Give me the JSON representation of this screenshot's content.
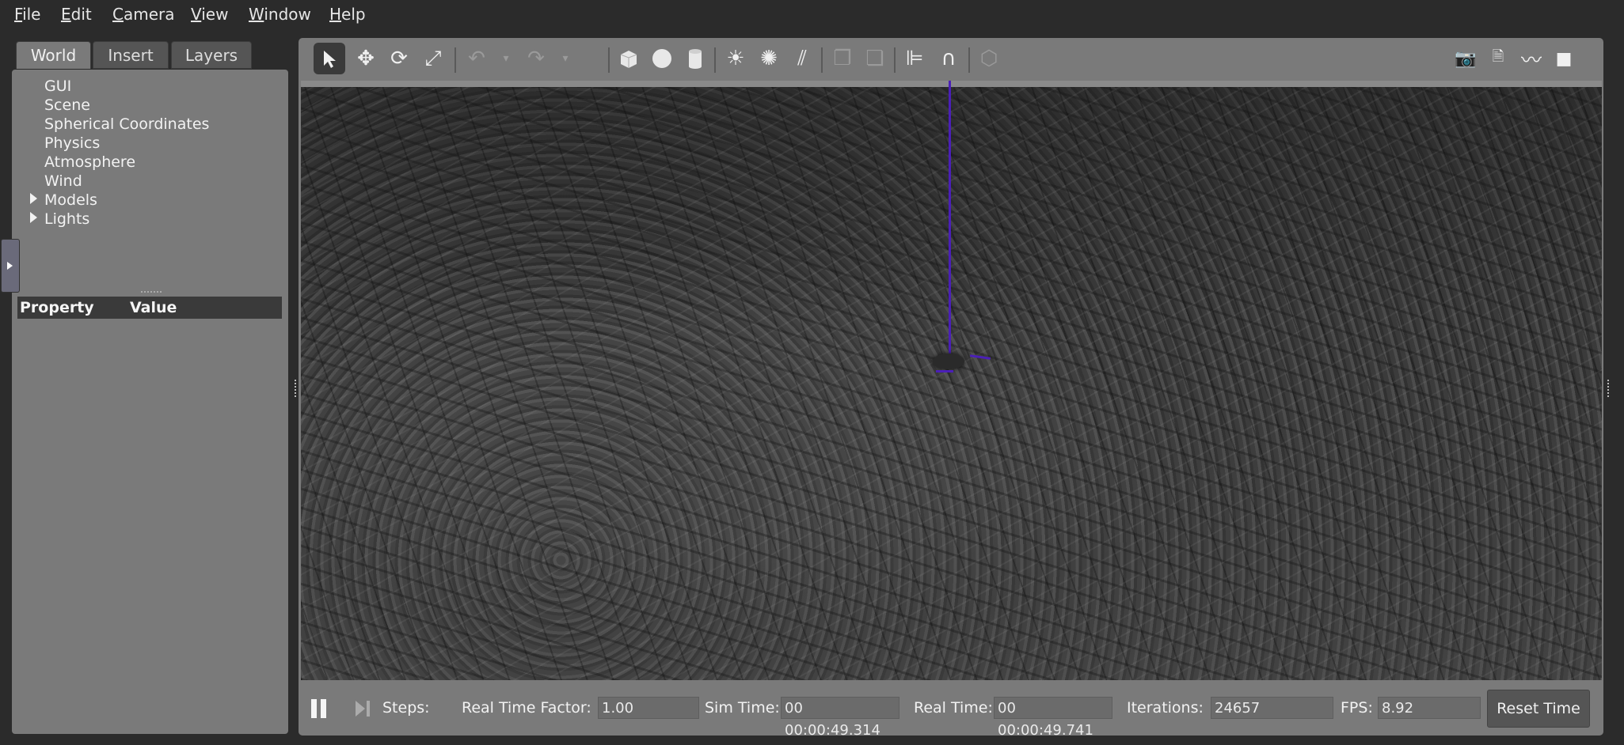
{
  "menu": [
    {
      "label": "File",
      "mnemonic": "F"
    },
    {
      "label": "Edit",
      "mnemonic": "E"
    },
    {
      "label": "Camera",
      "mnemonic": "C"
    },
    {
      "label": "View",
      "mnemonic": "V"
    },
    {
      "label": "Window",
      "mnemonic": "W"
    },
    {
      "label": "Help",
      "mnemonic": "H"
    }
  ],
  "tabs": [
    "World",
    "Insert",
    "Layers"
  ],
  "tree": [
    "GUI",
    "Scene",
    "Spherical Coordinates",
    "Physics",
    "Atmosphere",
    "Wind",
    "Models",
    "Lights"
  ],
  "property_table": {
    "col1": "Property",
    "col2": "Value"
  },
  "toolbar": {
    "icons": [
      "select-arrow-icon",
      "translate-icon",
      "rotate-icon",
      "scale-icon",
      "undo-icon",
      "redo-icon",
      "box-shape-icon",
      "sphere-shape-icon",
      "cylinder-shape-icon",
      "point-light-icon",
      "spot-light-icon",
      "directional-light-icon",
      "copy-icon",
      "paste-icon",
      "align-icon",
      "snap-icon",
      "view-angle-icon",
      "screenshot-icon",
      "log-icon",
      "plot-icon",
      "record-video-icon"
    ]
  },
  "bottom": {
    "steps_label": "Steps:",
    "rtf_label": "Real Time Factor:",
    "rtf_value": "1.00",
    "sim_time_label": "Sim Time:",
    "sim_time_value": "00 00:00:49.314",
    "real_time_label": "Real Time:",
    "real_time_value": "00 00:00:49.741",
    "iterations_label": "Iterations:",
    "iterations_value": "24657",
    "fps_label": "FPS:",
    "fps_value": "8.92",
    "reset_label": "Reset Time"
  },
  "colors": {
    "axis": "#4b1fb8",
    "panel": "#7a7a7a",
    "background": "#2b2b2b"
  }
}
